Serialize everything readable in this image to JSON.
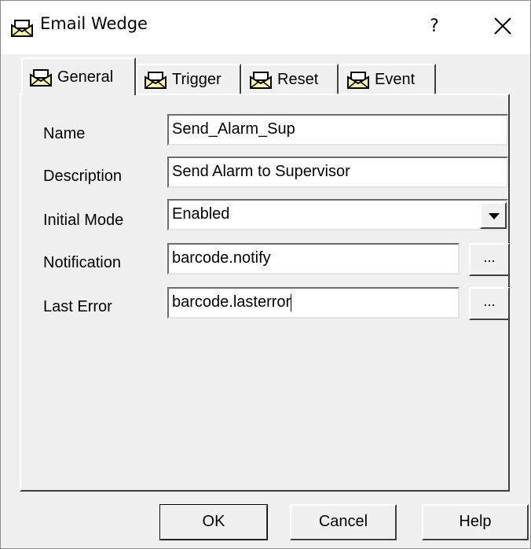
{
  "window": {
    "title": "Email Wedge",
    "help_label": "?",
    "close_label": "close",
    "title_icon": "email-icon"
  },
  "tabs": [
    {
      "label": "General",
      "active": true,
      "icon": "email-icon"
    },
    {
      "label": "Trigger",
      "active": false,
      "icon": "email-icon"
    },
    {
      "label": "Reset",
      "active": false,
      "icon": "email-icon"
    },
    {
      "label": "Event",
      "active": false,
      "icon": "email-icon"
    }
  ],
  "form": {
    "name": {
      "label": "Name",
      "value": "Send_Alarm_Sup"
    },
    "description": {
      "label": "Description",
      "value": "Send Alarm to Supervisor"
    },
    "initial_mode": {
      "label": "Initial Mode",
      "value": "Enabled"
    },
    "notification": {
      "label": "Notification",
      "value": "barcode.notify",
      "browse_label": "..."
    },
    "last_error": {
      "label": "Last Error",
      "value": "barcode.lasterror",
      "browse_label": "..."
    }
  },
  "buttons": {
    "ok": "OK",
    "cancel": "Cancel",
    "help": "Help"
  },
  "colors": {
    "dialog_bg": "#f0f0f0",
    "field_bg": "#ffffff",
    "titlebar_bg": "#ffffff"
  }
}
